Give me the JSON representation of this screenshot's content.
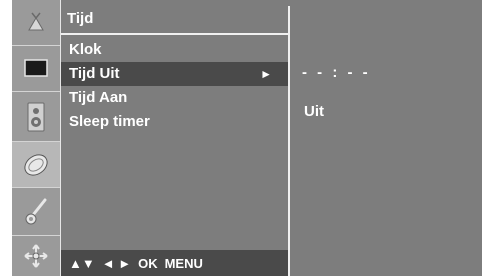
{
  "menu": {
    "title": "Tijd",
    "items": [
      {
        "label": "Klok"
      },
      {
        "label": "Tijd Uit",
        "selected": true,
        "submenu_arrow": "►"
      },
      {
        "label": "Tijd Aan"
      },
      {
        "label": "Sleep timer"
      }
    ]
  },
  "nav_hint": {
    "up_down": "▲▼",
    "left_right": "◄ ►",
    "ok": "OK",
    "menu": "MENU"
  },
  "value_panel": {
    "time_value": "- - : - -",
    "state_value": "Uit"
  },
  "icons": [
    {
      "name": "station-icon",
      "active": false
    },
    {
      "name": "picture-icon",
      "active": false
    },
    {
      "name": "sound-icon",
      "active": false
    },
    {
      "name": "time-icon",
      "active": true
    },
    {
      "name": "special-icon",
      "active": false
    },
    {
      "name": "screen-icon",
      "active": false
    }
  ],
  "colors": {
    "panel": "#7d7d7d",
    "highlight": "#4a4a4a",
    "icon_column": "#9a9a9a",
    "text": "#ffffff"
  }
}
